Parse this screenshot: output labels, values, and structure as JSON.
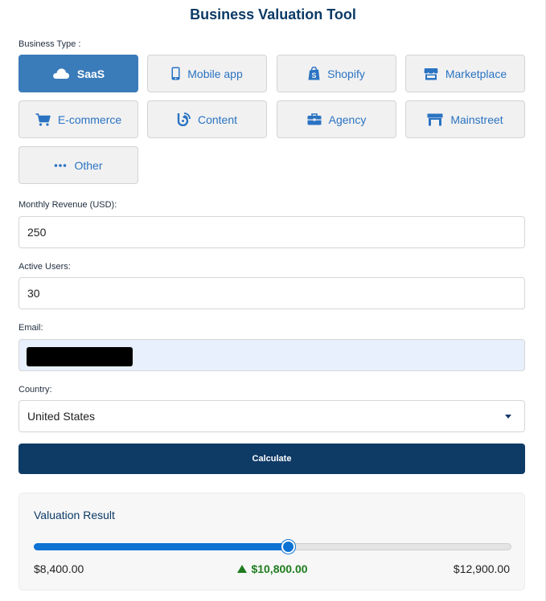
{
  "title": "Business Valuation Tool",
  "business_type": {
    "label": "Business Type :",
    "selected": "SaaS",
    "options": [
      {
        "label": "SaaS",
        "icon": "cloud-icon"
      },
      {
        "label": "Mobile app",
        "icon": "mobile-phone-icon"
      },
      {
        "label": "Shopify",
        "icon": "shopify-bag-icon"
      },
      {
        "label": "Marketplace",
        "icon": "storefront-icon"
      },
      {
        "label": "E-commerce",
        "icon": "shopping-cart-icon"
      },
      {
        "label": "Content",
        "icon": "blog-icon"
      },
      {
        "label": "Agency",
        "icon": "briefcase-icon"
      },
      {
        "label": "Mainstreet",
        "icon": "shop-icon"
      },
      {
        "label": "Other",
        "icon": "ellipsis-icon"
      }
    ]
  },
  "monthly_revenue": {
    "label": "Monthly Revenue (USD):",
    "value": "250"
  },
  "active_users": {
    "label": "Active Users:",
    "value": "30"
  },
  "email": {
    "label": "Email:",
    "value": ""
  },
  "country": {
    "label": "Country:",
    "value": "United States"
  },
  "calculate_label": "Calculate",
  "result": {
    "title": "Valuation Result",
    "min": "$8,400.00",
    "value": "$10,800.00",
    "max": "$12,900.00",
    "position_fraction": 0.533
  },
  "colors": {
    "accent": "#3a7bb9",
    "primary_dark": "#0e3a66",
    "slider": "#0c72d4",
    "positive": "#1e7c1e"
  }
}
